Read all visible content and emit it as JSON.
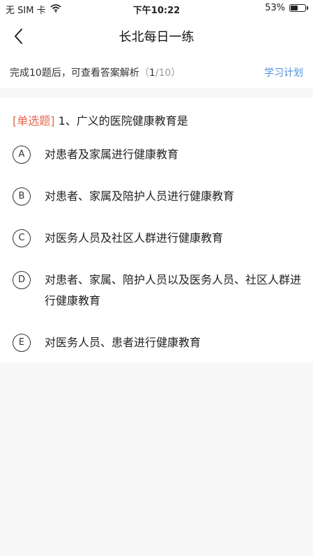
{
  "status_bar": {
    "carrier": "无 SIM 卡",
    "time": "下午10:22",
    "battery_percent": "53%",
    "battery_level": 0.53,
    "wifi_icon": "wifi-icon"
  },
  "nav": {
    "title": "长北每日一练",
    "back_icon": "chevron-left-icon"
  },
  "progress": {
    "hint": "完成10题后，可查看答案解析",
    "open_paren": "（",
    "current": "1",
    "total": "/10）",
    "study_plan_label": "学习计划",
    "accent_color": "#4a90e2"
  },
  "question": {
    "type_label": "[单选题]",
    "text": " 1、广义的医院健康教育是",
    "type_color": "#e8664f"
  },
  "options": [
    {
      "letter": "A",
      "text": "对患者及家属进行健康教育"
    },
    {
      "letter": "B",
      "text": "对患者、家属及陪护人员进行健康教育"
    },
    {
      "letter": "C",
      "text": "对医务人员及社区人群进行健康教育"
    },
    {
      "letter": "D",
      "text": "对患者、家属、陪护人员以及医务人员、社区人群进行健康教育"
    },
    {
      "letter": "E",
      "text": "对医务人员、患者进行健康教育"
    }
  ]
}
